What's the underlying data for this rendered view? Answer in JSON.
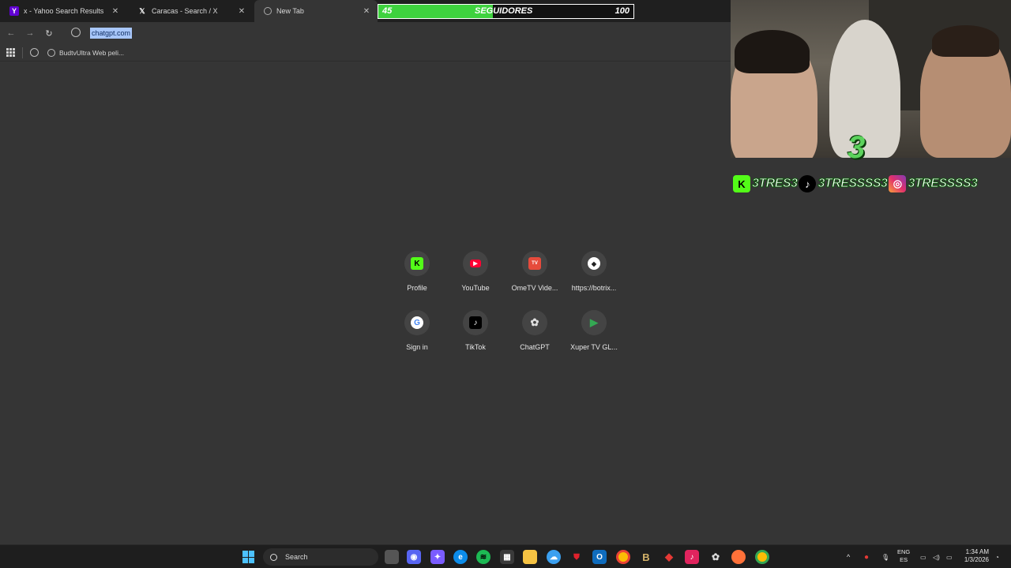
{
  "browser": {
    "tabs": [
      {
        "title": "x - Yahoo Search Results",
        "favicon": "yahoo-icon"
      },
      {
        "title": "Caracas - Search / X",
        "favicon": "x-icon"
      },
      {
        "title": "New Tab",
        "favicon": "globe-icon",
        "active": true
      }
    ],
    "address": "chatgpt.com",
    "bookmarks": [
      {
        "label": "BudtvUltra Web peli..."
      }
    ]
  },
  "overlay": {
    "followers_current": "45",
    "followers_label": "SEGUIDORES",
    "followers_goal": "100",
    "progress": 0.45,
    "socials": [
      {
        "icon": "kick-icon",
        "handle": "3TRES3"
      },
      {
        "icon": "tiktok-icon",
        "handle": "3TRESSSS3"
      },
      {
        "icon": "instagram-icon",
        "handle": "3TRESSSS3"
      }
    ],
    "logo_text": "3"
  },
  "shortcuts": [
    {
      "label": "Profile",
      "icon": "kick-icon"
    },
    {
      "label": "YouTube",
      "icon": "youtube-icon"
    },
    {
      "label": "OmeTV Vide...",
      "icon": "ometv-icon"
    },
    {
      "label": "https://botrix...",
      "icon": "botrix-icon"
    },
    {
      "label": "Sign in",
      "icon": "google-icon"
    },
    {
      "label": "TikTok",
      "icon": "tiktok-icon"
    },
    {
      "label": "ChatGPT",
      "icon": "chatgpt-icon"
    },
    {
      "label": "Xuper TV GL...",
      "icon": "play-store-icon"
    }
  ],
  "taskbar": {
    "search_label": "Search",
    "lang_top": "ENG",
    "lang_bottom": "ES",
    "time": "1:34 AM",
    "date": "1/3/2026"
  },
  "colors": {
    "accent_green": "#3ed23e",
    "background": "#353535"
  }
}
